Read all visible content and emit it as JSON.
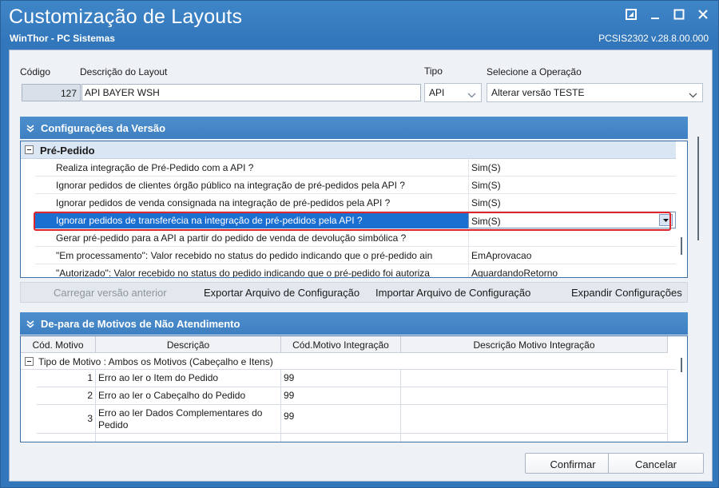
{
  "window": {
    "title": "Customização de Layouts",
    "subtitle": "WinThor - PC Sistemas",
    "version": "PCSIS2302  v.28.8.00.000"
  },
  "form": {
    "codigo_label": "Código",
    "codigo_value": "127",
    "descricao_label": "Descrição do Layout",
    "descricao_value": "API BAYER WSH",
    "tipo_label": "Tipo",
    "tipo_value": "API",
    "operacao_label": "Selecione a Operação",
    "operacao_value": "Alterar versão TESTE"
  },
  "config_panel": {
    "title": "Configurações da Versão",
    "group_label": "Pré-Pedido",
    "rows": [
      {
        "key": "Realiza integração de Pré-Pedido com a API ?",
        "value": "Sim(S)"
      },
      {
        "key": "Ignorar pedidos de clientes órgão público na integração de pré-pedidos pela API ?",
        "value": "Sim(S)"
      },
      {
        "key": "Ignorar pedidos de venda consignada na integração de pré-pedidos pela API ?",
        "value": "Sim(S)"
      },
      {
        "key": "Ignorar pedidos de transferêcia na integração de pré-pedidos pela API ?",
        "value": "Sim(S)"
      },
      {
        "key": "Gerar pré-pedido para a API a partir do pedido de venda de devolução simbólica ?",
        "value": ""
      },
      {
        "key": "\"Em processamento\": Valor recebido no status do pedido indicando que o pré-pedido ain",
        "value": "EmAprovacao"
      },
      {
        "key": "\"Autorizado\": Valor recebido no status do pedido indicando que o pré-pedido foi autoriza",
        "value": "AguardandoRetorno"
      }
    ]
  },
  "toolbar": {
    "carregar": "Carregar versão anterior",
    "exportar": "Exportar Arquivo de Configuração",
    "importar": "Importar Arquivo de Configuração",
    "expandir": "Expandir Configurações"
  },
  "motivos_panel": {
    "title": "De-para de Motivos de Não Atendimento",
    "headers": [
      "Cód. Motivo",
      "Descrição",
      "Cód.Motivo Integração",
      "Descrição Motivo Integração"
    ],
    "group_label": "Tipo de Motivo : Ambos os Motivos (Cabeçalho e Itens)",
    "rows": [
      {
        "cod": "1",
        "desc": "Erro ao ler o Item do Pedido",
        "cod_int": "99",
        "desc_int": ""
      },
      {
        "cod": "2",
        "desc": "Erro ao ler o Cabeçalho do Pedido",
        "cod_int": "99",
        "desc_int": ""
      },
      {
        "cod": "3",
        "desc": "Erro ao ler Dados Complementares do Pedido",
        "cod_int": "99",
        "desc_int": ""
      }
    ]
  },
  "buttons": {
    "confirmar": "Confirmar",
    "cancelar": "Cancelar"
  },
  "colors": {
    "titlebar": "#3277bb",
    "panel_header": "#3d7fc0",
    "selection": "#1b6fd1",
    "highlight": "#e0262b"
  }
}
